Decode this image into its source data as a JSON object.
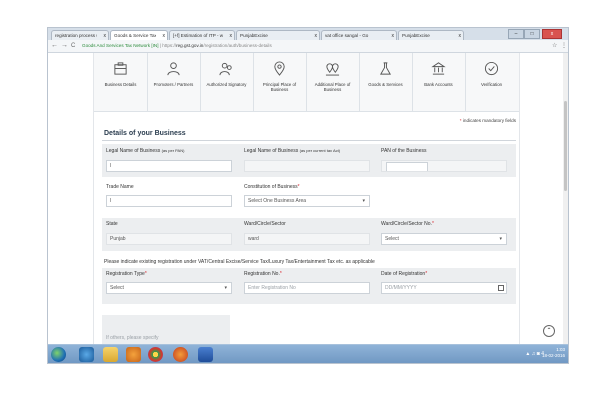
{
  "browser": {
    "tabs": [
      {
        "title": "registration process un"
      },
      {
        "title": "Goods & Service Tax (G"
      },
      {
        "title": "[+f] Estimation of ITP - wit"
      },
      {
        "title": "PunjabExcise"
      },
      {
        "title": "vat office sangal - Go"
      },
      {
        "title": "PunjabExcise"
      }
    ],
    "nav": {
      "back": "←",
      "forward": "→",
      "reload": "C"
    },
    "url": {
      "site": "Goods And Services Tax Network [IN]",
      "sep": " | ",
      "scheme": "https://",
      "host": "reg.gst.gov.in",
      "path": "/registration/auth/business-details"
    },
    "star": "☆",
    "menu": "⋮",
    "window_controls": {
      "min": "–",
      "max": "□",
      "close": "x"
    }
  },
  "steps": [
    {
      "label": "Business Details",
      "icon": "briefcase-icon"
    },
    {
      "label": "Promoters / Partners",
      "icon": "person-icon"
    },
    {
      "label": "Authorized Signatory",
      "icon": "people-icon"
    },
    {
      "label": "Principal Place of Business",
      "icon": "location-pin-icon"
    },
    {
      "label": "Additional Place of Business",
      "icon": "multi-location-icon"
    },
    {
      "label": "Goods & Services",
      "icon": "flask-icon"
    },
    {
      "label": "Bank Accounts",
      "icon": "bank-icon"
    },
    {
      "label": "Verification",
      "icon": "check-circle-icon"
    }
  ],
  "form": {
    "mandatory_star": "*",
    "mandatory_note": "indicates mandatory fields",
    "heading": "Details of your Business",
    "legal_name_label": "Legal Name of Business",
    "legal_name_hint": "(as per PAN)",
    "legal_name_value": "I",
    "legal_name_current_label": "Legal Name of Business",
    "legal_name_current_hint": "(as per current tax Act)",
    "pan_label": "PAN of the Business",
    "trade_name_label": "Trade Name",
    "trade_name_value": "I",
    "constitution_label": "Constitution of Business",
    "constitution_value": "Select One Business Area",
    "state_label": "State",
    "state_value": "Punjab",
    "ward_label": "Ward/Circle/Sector",
    "ward_value": "ward",
    "ward_no_label": "Ward/Circle/Sector No.",
    "ward_no_value": "Select",
    "existing_reg_note": "Please indicate existing registration under VAT/Central Excise/Service Tax/Luxury Tax/Entertainment Tax etc. as applicable",
    "reg_type_label": "Registration Type",
    "reg_type_value": "Select",
    "reg_no_label": "Registration No.",
    "reg_no_placeholder": "Enter Registration No",
    "reg_date_label": "Date of Registration",
    "reg_date_placeholder": "DD/MM/YYYY",
    "partial_label": "If others, please specify",
    "required_star": "*",
    "caret": "▾"
  },
  "scroll_top": "⌃",
  "taskbar": {
    "clock_time": "1:03",
    "clock_date": "18-02-2016",
    "tray": "▲ ♫ ◙ 4"
  }
}
